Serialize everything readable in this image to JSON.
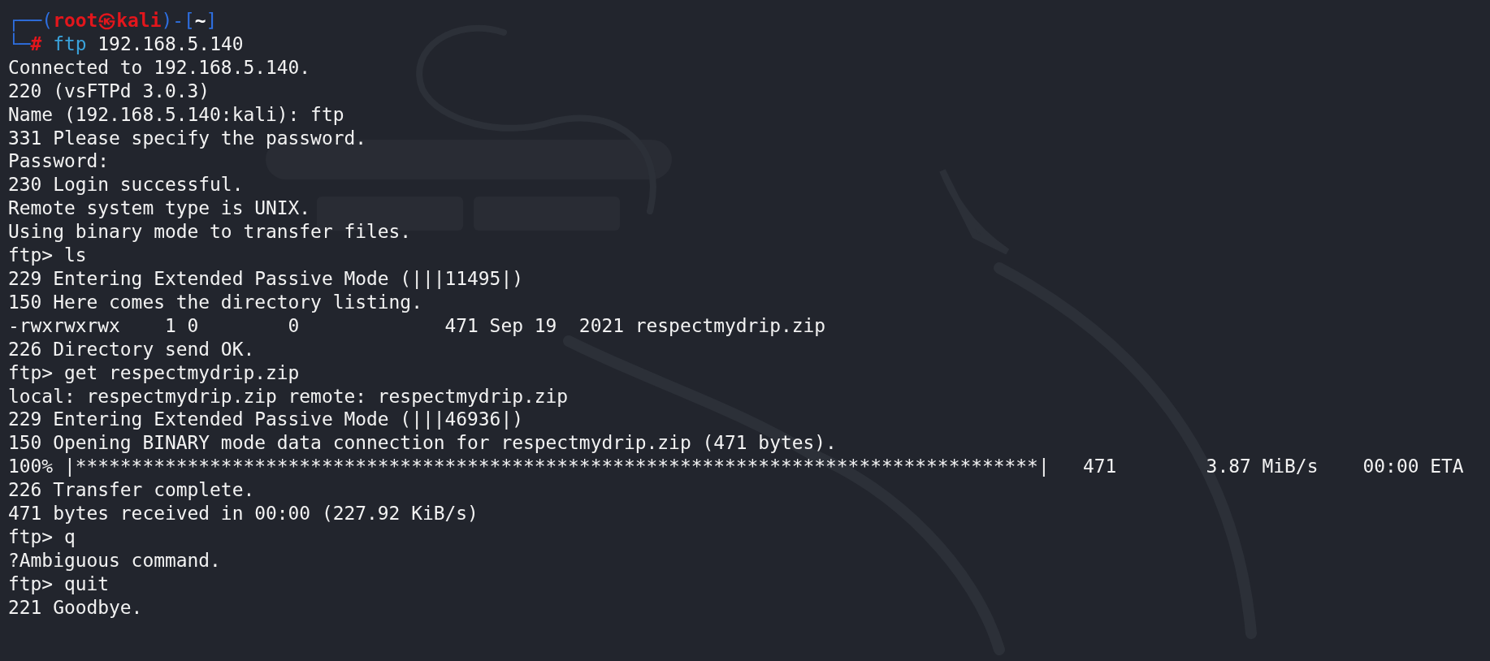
{
  "terminal": {
    "prompt": {
      "corner_top": "┌──(",
      "user": "root",
      "at": "㉿",
      "host": "kali",
      "mid": ")-[",
      "cwd": "~",
      "close": "]",
      "corner_bottom": "└─",
      "symbol": "#",
      "command": "ftp",
      "args": "192.168.5.140"
    },
    "lines": [
      "Connected to 192.168.5.140.",
      "220 (vsFTPd 3.0.3)",
      "Name (192.168.5.140:kali): ftp",
      "331 Please specify the password.",
      "Password:",
      "230 Login successful.",
      "Remote system type is UNIX.",
      "Using binary mode to transfer files.",
      "ftp> ls",
      "229 Entering Extended Passive Mode (|||11495|)",
      "150 Here comes the directory listing.",
      "-rwxrwxrwx    1 0        0             471 Sep 19  2021 respectmydrip.zip",
      "226 Directory send OK.",
      "ftp> get respectmydrip.zip",
      "local: respectmydrip.zip remote: respectmydrip.zip",
      "229 Entering Extended Passive Mode (|||46936|)",
      "150 Opening BINARY mode data connection for respectmydrip.zip (471 bytes).",
      "100% |**************************************************************************************|   471        3.87 MiB/s    00:00 ETA",
      "226 Transfer complete.",
      "471 bytes received in 00:00 (227.92 KiB/s)",
      "ftp> q",
      "?Ambiguous command.",
      "ftp> quit",
      "221 Goodbye."
    ]
  }
}
